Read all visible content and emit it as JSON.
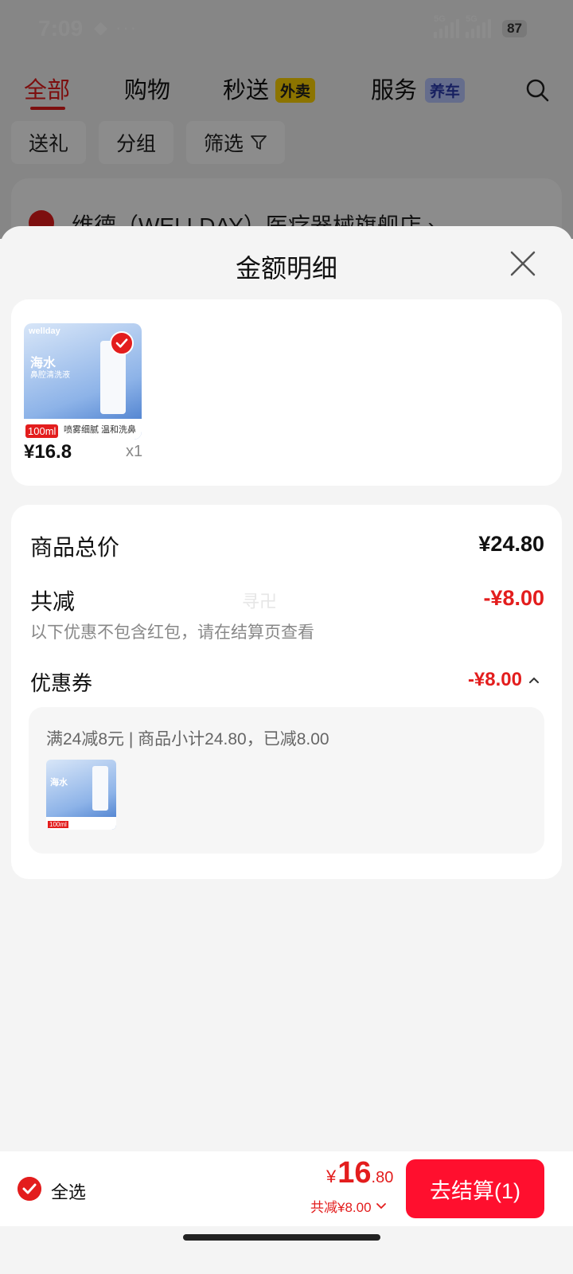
{
  "status_bar": {
    "time": "7:09",
    "misc": "◆ ···",
    "net1": "5G",
    "net2": "5G",
    "battery": "87"
  },
  "tabs": [
    {
      "label": "全部",
      "active": true
    },
    {
      "label": "购物"
    },
    {
      "label": "秒送",
      "badge": "外卖"
    },
    {
      "label": "服务",
      "badge": "养车"
    }
  ],
  "filters": {
    "gift": "送礼",
    "group": "分组",
    "filter": "筛选"
  },
  "store": {
    "name": "维德（WELLDAY）医疗器械旗舰店 ›"
  },
  "sheet": {
    "title": "金额明细",
    "product": {
      "brand": "wellday",
      "thumb_title": "海水",
      "thumb_sub": "鼻腔清洗液",
      "thumb_volume": "100ml",
      "thumb_tag": "喷雾细腻 温和洗鼻",
      "price": "¥16.8",
      "qty": "x1"
    },
    "summary": {
      "total_label": "商品总价",
      "total_value": "¥24.80",
      "reduce_label": "共减",
      "reduce_value": "-¥8.00",
      "note": "以下优惠不包含红包，请在结算页查看",
      "watermark": "寻卍",
      "coupon_label": "优惠券",
      "coupon_value": "-¥8.00",
      "coupon_desc": "满24减8元 | 商品小计24.80，已减8.00"
    }
  },
  "bottom": {
    "select_all": "全选",
    "yen": "¥",
    "amount_int": "16",
    "amount_dec": ".80",
    "reduce_text": "共减¥8.00",
    "checkout": "去结算(1)"
  },
  "colors": {
    "accent": "#e31d1d",
    "button": "#ff0f2e"
  }
}
